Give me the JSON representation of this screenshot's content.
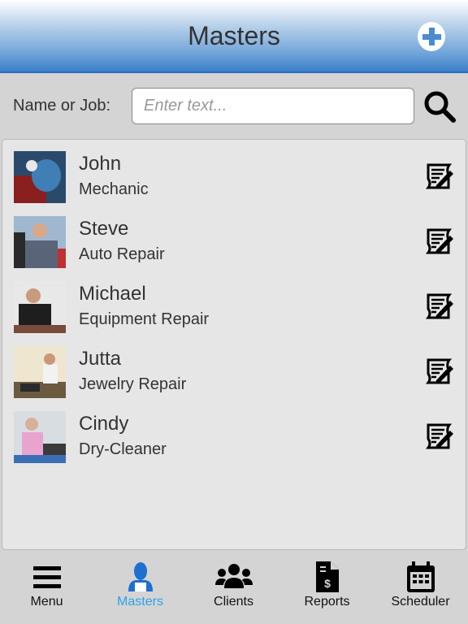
{
  "header": {
    "title": "Masters",
    "add_button": "plus-circle"
  },
  "search": {
    "label": "Name or Job:",
    "placeholder": "Enter text...",
    "value": ""
  },
  "masters": [
    {
      "name": "John",
      "job": "Mechanic",
      "photo_colors": [
        "#2b4a6b",
        "#8a1f1f",
        "#3f7fb5"
      ]
    },
    {
      "name": "Steve",
      "job": "Auto Repair",
      "photo_colors": [
        "#9fb8d0",
        "#5a6478",
        "#d9dde3"
      ]
    },
    {
      "name": "Michael",
      "job": "Equipment Repair",
      "photo_colors": [
        "#e8e8e8",
        "#1e1e1e",
        "#7a4a3a"
      ]
    },
    {
      "name": "Jutta",
      "job": "Jewelry Repair",
      "photo_colors": [
        "#efe6d0",
        "#6b5a40",
        "#f2f2f2"
      ]
    },
    {
      "name": "Cindy",
      "job": "Dry-Cleaner",
      "photo_colors": [
        "#d8dde2",
        "#e9a3cf",
        "#3b6fb5"
      ]
    }
  ],
  "tabs": [
    {
      "label": "Menu",
      "icon": "menu-icon",
      "active": false
    },
    {
      "label": "Masters",
      "icon": "user-icon",
      "active": true
    },
    {
      "label": "Clients",
      "icon": "users-icon",
      "active": false
    },
    {
      "label": "Reports",
      "icon": "report-icon",
      "active": false
    },
    {
      "label": "Scheduler",
      "icon": "calendar-icon",
      "active": false
    }
  ],
  "colors": {
    "accent": "#29a3e8",
    "active_icon": "#1e6fd0",
    "header_bottom": "#3b7fc8"
  }
}
